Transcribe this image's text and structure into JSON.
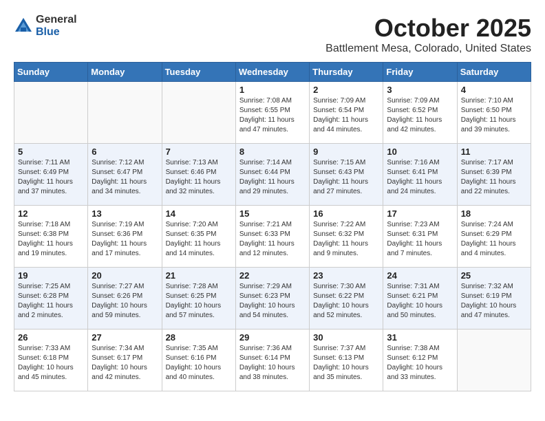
{
  "header": {
    "logo_general": "General",
    "logo_blue": "Blue",
    "month_title": "October 2025",
    "location": "Battlement Mesa, Colorado, United States"
  },
  "days_of_week": [
    "Sunday",
    "Monday",
    "Tuesday",
    "Wednesday",
    "Thursday",
    "Friday",
    "Saturday"
  ],
  "weeks": [
    [
      {
        "num": "",
        "info": ""
      },
      {
        "num": "",
        "info": ""
      },
      {
        "num": "",
        "info": ""
      },
      {
        "num": "1",
        "info": "Sunrise: 7:08 AM\nSunset: 6:55 PM\nDaylight: 11 hours\nand 47 minutes."
      },
      {
        "num": "2",
        "info": "Sunrise: 7:09 AM\nSunset: 6:54 PM\nDaylight: 11 hours\nand 44 minutes."
      },
      {
        "num": "3",
        "info": "Sunrise: 7:09 AM\nSunset: 6:52 PM\nDaylight: 11 hours\nand 42 minutes."
      },
      {
        "num": "4",
        "info": "Sunrise: 7:10 AM\nSunset: 6:50 PM\nDaylight: 11 hours\nand 39 minutes."
      }
    ],
    [
      {
        "num": "5",
        "info": "Sunrise: 7:11 AM\nSunset: 6:49 PM\nDaylight: 11 hours\nand 37 minutes."
      },
      {
        "num": "6",
        "info": "Sunrise: 7:12 AM\nSunset: 6:47 PM\nDaylight: 11 hours\nand 34 minutes."
      },
      {
        "num": "7",
        "info": "Sunrise: 7:13 AM\nSunset: 6:46 PM\nDaylight: 11 hours\nand 32 minutes."
      },
      {
        "num": "8",
        "info": "Sunrise: 7:14 AM\nSunset: 6:44 PM\nDaylight: 11 hours\nand 29 minutes."
      },
      {
        "num": "9",
        "info": "Sunrise: 7:15 AM\nSunset: 6:43 PM\nDaylight: 11 hours\nand 27 minutes."
      },
      {
        "num": "10",
        "info": "Sunrise: 7:16 AM\nSunset: 6:41 PM\nDaylight: 11 hours\nand 24 minutes."
      },
      {
        "num": "11",
        "info": "Sunrise: 7:17 AM\nSunset: 6:39 PM\nDaylight: 11 hours\nand 22 minutes."
      }
    ],
    [
      {
        "num": "12",
        "info": "Sunrise: 7:18 AM\nSunset: 6:38 PM\nDaylight: 11 hours\nand 19 minutes."
      },
      {
        "num": "13",
        "info": "Sunrise: 7:19 AM\nSunset: 6:36 PM\nDaylight: 11 hours\nand 17 minutes."
      },
      {
        "num": "14",
        "info": "Sunrise: 7:20 AM\nSunset: 6:35 PM\nDaylight: 11 hours\nand 14 minutes."
      },
      {
        "num": "15",
        "info": "Sunrise: 7:21 AM\nSunset: 6:33 PM\nDaylight: 11 hours\nand 12 minutes."
      },
      {
        "num": "16",
        "info": "Sunrise: 7:22 AM\nSunset: 6:32 PM\nDaylight: 11 hours\nand 9 minutes."
      },
      {
        "num": "17",
        "info": "Sunrise: 7:23 AM\nSunset: 6:31 PM\nDaylight: 11 hours\nand 7 minutes."
      },
      {
        "num": "18",
        "info": "Sunrise: 7:24 AM\nSunset: 6:29 PM\nDaylight: 11 hours\nand 4 minutes."
      }
    ],
    [
      {
        "num": "19",
        "info": "Sunrise: 7:25 AM\nSunset: 6:28 PM\nDaylight: 11 hours\nand 2 minutes."
      },
      {
        "num": "20",
        "info": "Sunrise: 7:27 AM\nSunset: 6:26 PM\nDaylight: 10 hours\nand 59 minutes."
      },
      {
        "num": "21",
        "info": "Sunrise: 7:28 AM\nSunset: 6:25 PM\nDaylight: 10 hours\nand 57 minutes."
      },
      {
        "num": "22",
        "info": "Sunrise: 7:29 AM\nSunset: 6:23 PM\nDaylight: 10 hours\nand 54 minutes."
      },
      {
        "num": "23",
        "info": "Sunrise: 7:30 AM\nSunset: 6:22 PM\nDaylight: 10 hours\nand 52 minutes."
      },
      {
        "num": "24",
        "info": "Sunrise: 7:31 AM\nSunset: 6:21 PM\nDaylight: 10 hours\nand 50 minutes."
      },
      {
        "num": "25",
        "info": "Sunrise: 7:32 AM\nSunset: 6:19 PM\nDaylight: 10 hours\nand 47 minutes."
      }
    ],
    [
      {
        "num": "26",
        "info": "Sunrise: 7:33 AM\nSunset: 6:18 PM\nDaylight: 10 hours\nand 45 minutes."
      },
      {
        "num": "27",
        "info": "Sunrise: 7:34 AM\nSunset: 6:17 PM\nDaylight: 10 hours\nand 42 minutes."
      },
      {
        "num": "28",
        "info": "Sunrise: 7:35 AM\nSunset: 6:16 PM\nDaylight: 10 hours\nand 40 minutes."
      },
      {
        "num": "29",
        "info": "Sunrise: 7:36 AM\nSunset: 6:14 PM\nDaylight: 10 hours\nand 38 minutes."
      },
      {
        "num": "30",
        "info": "Sunrise: 7:37 AM\nSunset: 6:13 PM\nDaylight: 10 hours\nand 35 minutes."
      },
      {
        "num": "31",
        "info": "Sunrise: 7:38 AM\nSunset: 6:12 PM\nDaylight: 10 hours\nand 33 minutes."
      },
      {
        "num": "",
        "info": ""
      }
    ]
  ]
}
